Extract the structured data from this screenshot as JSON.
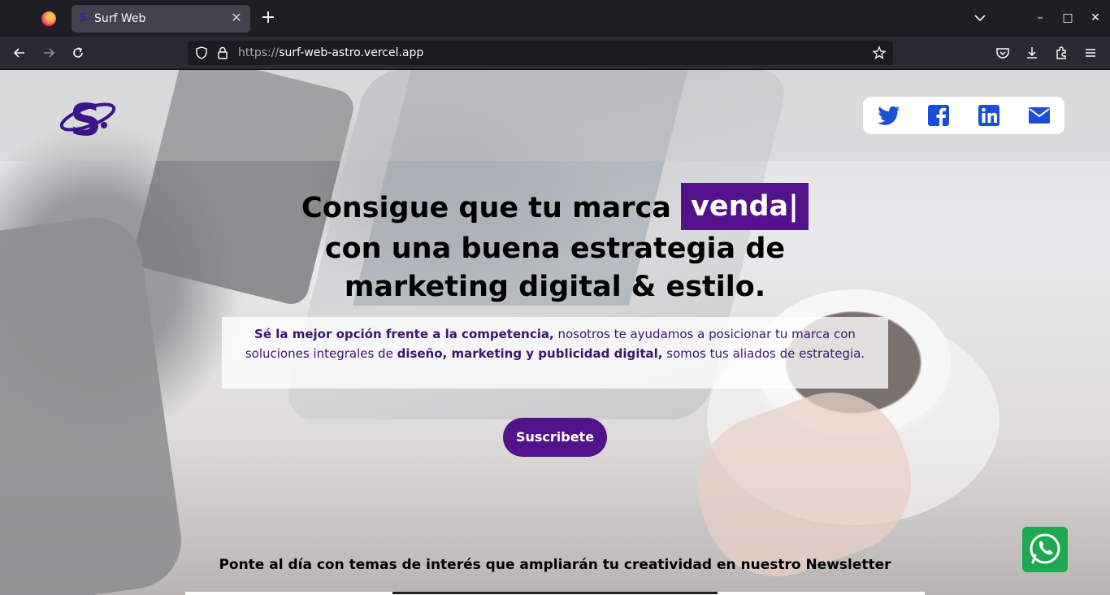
{
  "browser": {
    "tab_title": "Surf Web",
    "tab_favicon": "S",
    "tab_close": "✕",
    "new_tab": "+",
    "url_protocol": "https://",
    "url_host": "surf-web-astro.vercel.app",
    "window_controls": {
      "minimize": "–",
      "maximize": "□",
      "close": "✕"
    }
  },
  "header": {
    "logo_alt": "Surf Web logo",
    "social": [
      "twitter-icon",
      "facebook-icon",
      "linkedin-icon",
      "mail-icon"
    ]
  },
  "hero": {
    "headline_line1": "Consigue que tu marca",
    "typed_word": "venda|",
    "headline_line2": "con una buena estrategia de",
    "headline_line3": "marketing digital & estilo.",
    "intro_bold1": "Sé la mejor opción frente a la competencia,",
    "intro_text1": " nosotros te ayudamos a posicionar tu marca con soluciones integrales de ",
    "intro_bold2": "diseño, marketing y publicidad digital,",
    "intro_text2": " somos tus aliados de estrategia.",
    "subscribe_label": "Suscribete"
  },
  "newsletter": {
    "title": "Ponte al día con temas de interés que ampliarán tu creatividad en nuestro Newsletter"
  },
  "colors": {
    "brand_purple": "#52138a",
    "social_blue": "#1d4ed8",
    "whatsapp_green": "#1da851"
  }
}
